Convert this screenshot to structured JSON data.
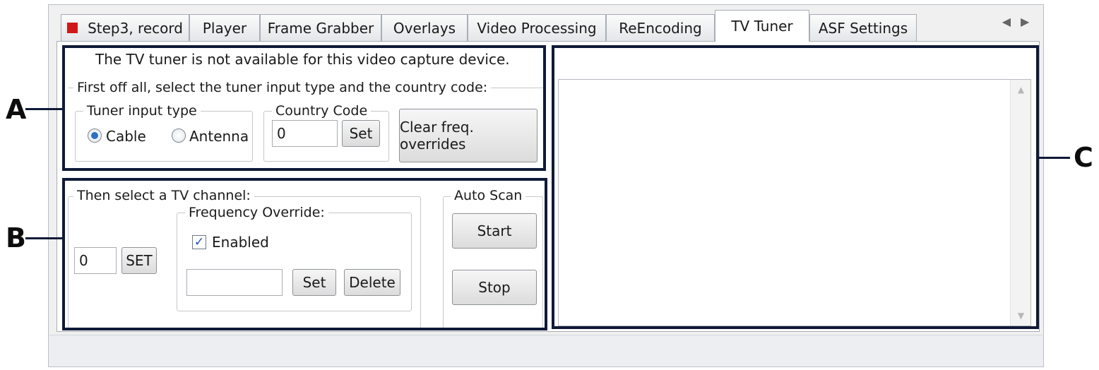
{
  "tabs": [
    {
      "label": "Step3, record"
    },
    {
      "label": "Player"
    },
    {
      "label": "Frame Grabber"
    },
    {
      "label": "Overlays"
    },
    {
      "label": "Video Processing"
    },
    {
      "label": "ReEncoding"
    },
    {
      "label": "TV Tuner"
    },
    {
      "label": "ASF Settings"
    }
  ],
  "active_tab": "TV Tuner",
  "callouts": {
    "a": "A",
    "b": "B",
    "c": "C"
  },
  "section_a": {
    "notice": "The TV tuner is not available for this video capture device.",
    "instruction": "First off all, select the tuner input type and the country code:",
    "tuner_input_legend": "Tuner input type",
    "radio_cable": "Cable",
    "radio_antenna": "Antenna",
    "selected_input": "Cable",
    "country_code_legend": "Country Code",
    "country_code_value": "0",
    "set_label": "Set",
    "clear_label": "Clear freq. overrides"
  },
  "section_b": {
    "channel_legend": "Then select a TV channel:",
    "channel_value": "0",
    "set_channel_label": "SET",
    "freq_override_legend": "Frequency Override:",
    "enabled_label": "Enabled",
    "enabled_checked": true,
    "freq_value": "",
    "freq_set_label": "Set",
    "freq_delete_label": "Delete",
    "auto_scan_legend": "Auto Scan",
    "start_label": "Start",
    "stop_label": "Stop"
  },
  "section_c": {
    "log_text": ""
  }
}
